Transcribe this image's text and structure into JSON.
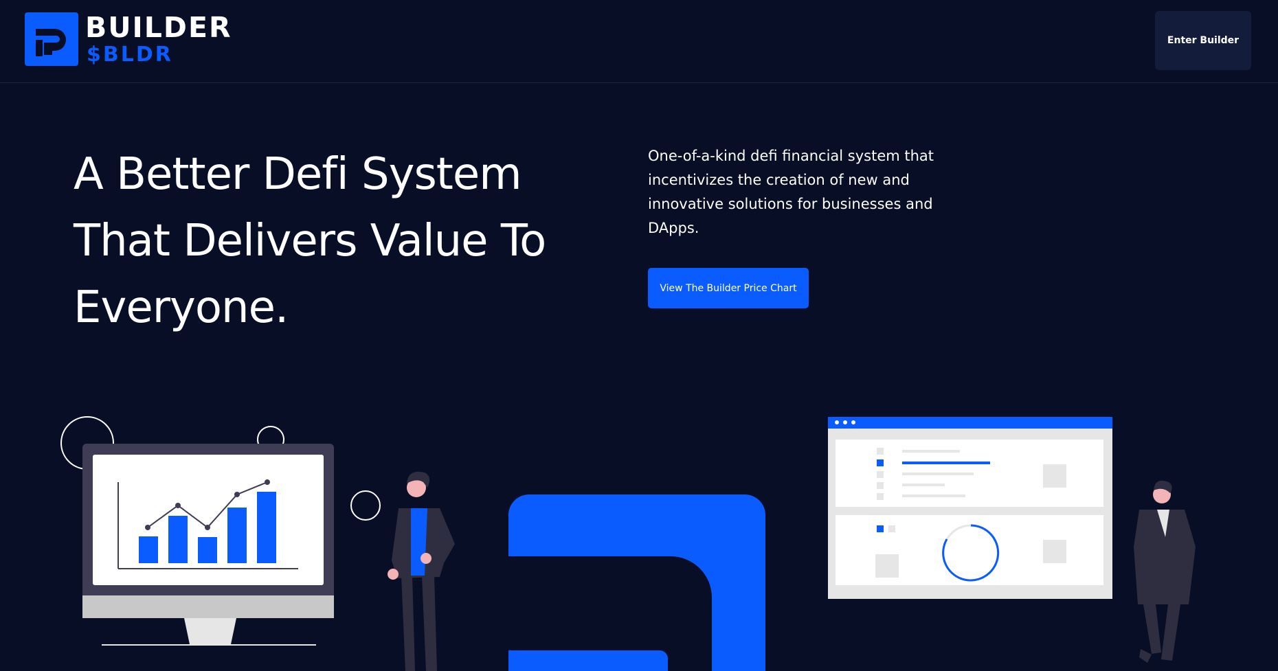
{
  "header": {
    "logo_title": "BUILDER",
    "logo_ticker": "$BLDR",
    "enter_button": "Enter Builder"
  },
  "hero": {
    "title": "A Better Defi System That Delivers Value To Everyone.",
    "description": "One-of-a-kind defi financial system that incentivizes the creation of new and innovative solutions for businesses and DApps.",
    "cta_button": "View The Builder Price Chart"
  },
  "colors": {
    "background": "#080e26",
    "accent": "#0a5cff",
    "button_dark": "#141c3c"
  },
  "icons": [
    "builder-logo-icon",
    "monitor-chart-illustration",
    "dashboard-window-illustration"
  ]
}
